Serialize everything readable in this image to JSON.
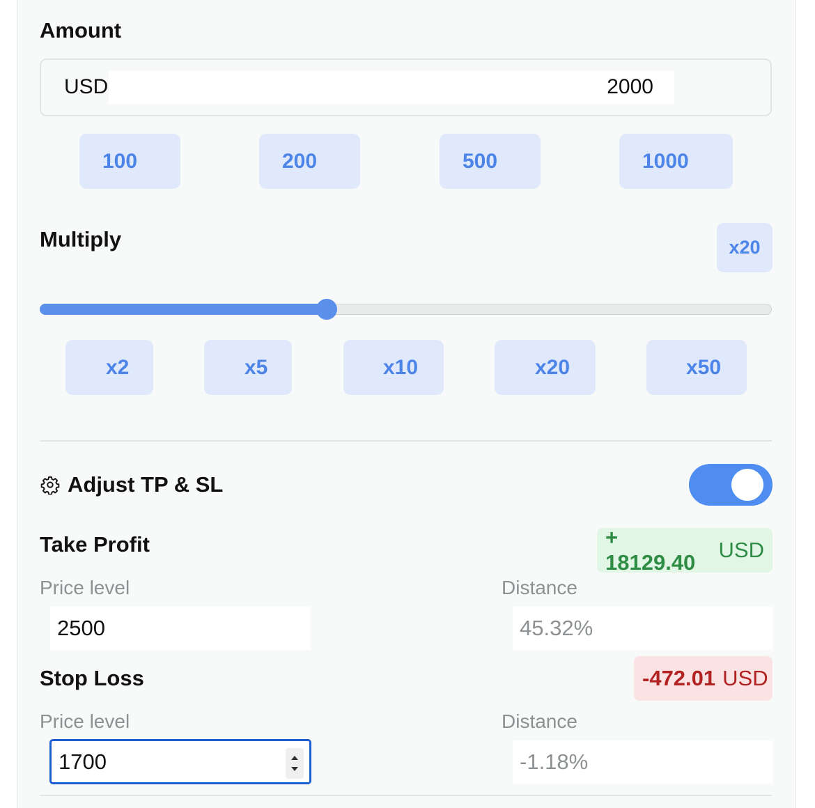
{
  "amount": {
    "label": "Amount",
    "currency": "USD",
    "value": "2000",
    "presets": [
      "100",
      "200",
      "500",
      "1000"
    ]
  },
  "multiply": {
    "label": "Multiply",
    "current": "x20",
    "slider_level_fraction": 0.4,
    "presets": [
      "x2",
      "x5",
      "x10",
      "x20",
      "x50"
    ]
  },
  "tpsl": {
    "icon": "gear-icon",
    "label": "Adjust TP & SL",
    "toggle_on": true,
    "accent_color": "#4f8ef0"
  },
  "take_profit": {
    "label": "Take Profit",
    "profit_value": "+ 18129.40",
    "profit_unit": "USD",
    "price_level_label": "Price level",
    "price_level_value": "2500",
    "distance_label": "Distance",
    "distance_value": "45.32%",
    "badge_color": "#2e8c45"
  },
  "stop_loss": {
    "label": "Stop Loss",
    "loss_value": "-472.01",
    "loss_unit": "USD",
    "price_level_label": "Price level",
    "price_level_value": "1700",
    "distance_label": "Distance",
    "distance_value": "-1.18%",
    "badge_color": "#b22222"
  }
}
